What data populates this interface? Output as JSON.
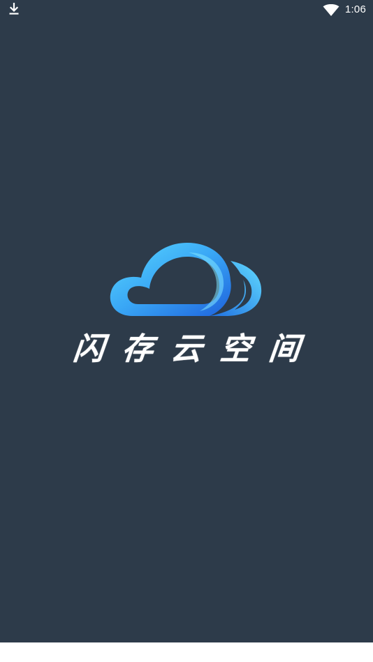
{
  "status_bar": {
    "time": "1:06",
    "left_icon": "download-icon",
    "right_icon": "wifi-icon"
  },
  "splash": {
    "logo_icon": "cloud-logo-icon",
    "app_name": "闪存云空间"
  },
  "colors": {
    "background": "#2d3b4a",
    "logo_light": "#4fd0ff",
    "logo_dark": "#1f6fe0",
    "text": "#ffffff"
  }
}
